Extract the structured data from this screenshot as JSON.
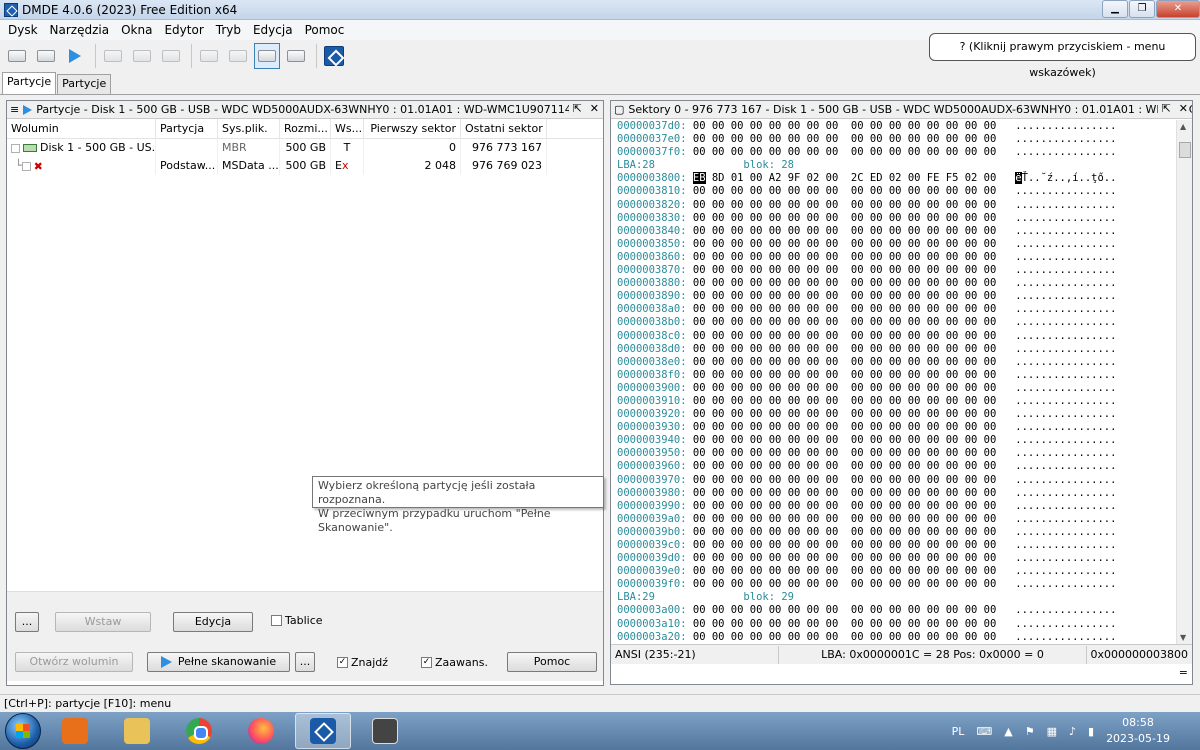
{
  "window": {
    "title": "DMDE 4.0.6 (2023) Free Edition x64"
  },
  "menu": [
    "Dysk",
    "Narzędzia",
    "Okna",
    "Edytor",
    "Tryb",
    "Edycja",
    "Pomoc"
  ],
  "hint": "? (Kliknij prawym przyciskiem - menu wskazówek)",
  "tabs": [
    "Partycje",
    "Partycje"
  ],
  "left_panel": {
    "title": "Partycje - Disk 1 - 500 GB - USB - WDC WD5000AUDX-63WNHY0 : 01.01A01 : WD-WMC1U9071143",
    "columns": [
      "Wolumin",
      "Partycja",
      "Sys.plik.",
      "Rozmi...",
      "Ws...",
      "Pierwszy sektor",
      "Ostatni sektor"
    ],
    "rows": [
      {
        "name": "Disk 1 - 500 GB - US...",
        "partition": "",
        "fs": "MBR",
        "size": "500 GB",
        "flag": "T",
        "first": "0",
        "last": "976 773 167"
      },
      {
        "name": "",
        "partition": "Podstaw...",
        "fs": "MSData ...",
        "size": "500 GB",
        "flag": "E",
        "flag2": "x",
        "first": "2 048",
        "last": "976 769 023"
      }
    ],
    "buttons": {
      "dots1": "...",
      "insert": "Wstaw",
      "edit": "Edycja",
      "tables": "Tablice",
      "open_volume": "Otwórz wolumin",
      "full_scan": "Pełne skanowanie",
      "dots2": "...",
      "find": "Znajdź",
      "advanced": "Zaawans.",
      "help": "Pomoc"
    }
  },
  "tooltip": {
    "line1": "Wybierz określoną partycję jeśli została rozpoznana.",
    "line2": "W przeciwnym przypadku uruchom \"Pełne Skanowanie\"."
  },
  "right_panel": {
    "title": "Sektory 0 - 976 773 167 - Disk 1 - 500 GB - USB - WDC WD5000AUDX-63WNHY0 : 01.01A01 : WD-WMC1U9...",
    "hex_rows": [
      {
        "addr": "00000037d0:",
        "bytes": "00 00 00 00 00 00 00 00  00 00 00 00 00 00 00 00",
        "ascii": "................"
      },
      {
        "addr": "00000037e0:",
        "bytes": "00 00 00 00 00 00 00 00  00 00 00 00 00 00 00 00",
        "ascii": "................"
      },
      {
        "addr": "00000037f0:",
        "bytes": "00 00 00 00 00 00 00 00  00 00 00 00 00 00 00 00",
        "ascii": "................"
      },
      {
        "lba": "LBA:28              blok: 28"
      },
      {
        "addr": "0000003800:",
        "first": "EB",
        "bytes": " 8D 01 00 A2 9F 02 00  2C ED 02 00 FE F5 02 00",
        "afirst": "ë",
        "ascii": "Ť..˘ź..,í..ţő.."
      },
      {
        "addr": "0000003810:",
        "bytes": "00 00 00 00 00 00 00 00  00 00 00 00 00 00 00 00",
        "ascii": "................"
      },
      {
        "addr": "0000003820:",
        "bytes": "00 00 00 00 00 00 00 00  00 00 00 00 00 00 00 00",
        "ascii": "................"
      },
      {
        "addr": "0000003830:",
        "bytes": "00 00 00 00 00 00 00 00  00 00 00 00 00 00 00 00",
        "ascii": "................"
      },
      {
        "addr": "0000003840:",
        "bytes": "00 00 00 00 00 00 00 00  00 00 00 00 00 00 00 00",
        "ascii": "................"
      },
      {
        "addr": "0000003850:",
        "bytes": "00 00 00 00 00 00 00 00  00 00 00 00 00 00 00 00",
        "ascii": "................"
      },
      {
        "addr": "0000003860:",
        "bytes": "00 00 00 00 00 00 00 00  00 00 00 00 00 00 00 00",
        "ascii": "................"
      },
      {
        "addr": "0000003870:",
        "bytes": "00 00 00 00 00 00 00 00  00 00 00 00 00 00 00 00",
        "ascii": "................"
      },
      {
        "addr": "0000003880:",
        "bytes": "00 00 00 00 00 00 00 00  00 00 00 00 00 00 00 00",
        "ascii": "................"
      },
      {
        "addr": "0000003890:",
        "bytes": "00 00 00 00 00 00 00 00  00 00 00 00 00 00 00 00",
        "ascii": "................"
      },
      {
        "addr": "00000038a0:",
        "bytes": "00 00 00 00 00 00 00 00  00 00 00 00 00 00 00 00",
        "ascii": "................"
      },
      {
        "addr": "00000038b0:",
        "bytes": "00 00 00 00 00 00 00 00  00 00 00 00 00 00 00 00",
        "ascii": "................"
      },
      {
        "addr": "00000038c0:",
        "bytes": "00 00 00 00 00 00 00 00  00 00 00 00 00 00 00 00",
        "ascii": "................"
      },
      {
        "addr": "00000038d0:",
        "bytes": "00 00 00 00 00 00 00 00  00 00 00 00 00 00 00 00",
        "ascii": "................"
      },
      {
        "addr": "00000038e0:",
        "bytes": "00 00 00 00 00 00 00 00  00 00 00 00 00 00 00 00",
        "ascii": "................"
      },
      {
        "addr": "00000038f0:",
        "bytes": "00 00 00 00 00 00 00 00  00 00 00 00 00 00 00 00",
        "ascii": "................"
      },
      {
        "addr": "0000003900:",
        "bytes": "00 00 00 00 00 00 00 00  00 00 00 00 00 00 00 00",
        "ascii": "................"
      },
      {
        "addr": "0000003910:",
        "bytes": "00 00 00 00 00 00 00 00  00 00 00 00 00 00 00 00",
        "ascii": "................"
      },
      {
        "addr": "0000003920:",
        "bytes": "00 00 00 00 00 00 00 00  00 00 00 00 00 00 00 00",
        "ascii": "................"
      },
      {
        "addr": "0000003930:",
        "bytes": "00 00 00 00 00 00 00 00  00 00 00 00 00 00 00 00",
        "ascii": "................"
      },
      {
        "addr": "0000003940:",
        "bytes": "00 00 00 00 00 00 00 00  00 00 00 00 00 00 00 00",
        "ascii": "................"
      },
      {
        "addr": "0000003950:",
        "bytes": "00 00 00 00 00 00 00 00  00 00 00 00 00 00 00 00",
        "ascii": "................"
      },
      {
        "addr": "0000003960:",
        "bytes": "00 00 00 00 00 00 00 00  00 00 00 00 00 00 00 00",
        "ascii": "................"
      },
      {
        "addr": "0000003970:",
        "bytes": "00 00 00 00 00 00 00 00  00 00 00 00 00 00 00 00",
        "ascii": "................"
      },
      {
        "addr": "0000003980:",
        "bytes": "00 00 00 00 00 00 00 00  00 00 00 00 00 00 00 00",
        "ascii": "................"
      },
      {
        "addr": "0000003990:",
        "bytes": "00 00 00 00 00 00 00 00  00 00 00 00 00 00 00 00",
        "ascii": "................"
      },
      {
        "addr": "00000039a0:",
        "bytes": "00 00 00 00 00 00 00 00  00 00 00 00 00 00 00 00",
        "ascii": "................"
      },
      {
        "addr": "00000039b0:",
        "bytes": "00 00 00 00 00 00 00 00  00 00 00 00 00 00 00 00",
        "ascii": "................"
      },
      {
        "addr": "00000039c0:",
        "bytes": "00 00 00 00 00 00 00 00  00 00 00 00 00 00 00 00",
        "ascii": "................"
      },
      {
        "addr": "00000039d0:",
        "bytes": "00 00 00 00 00 00 00 00  00 00 00 00 00 00 00 00",
        "ascii": "................"
      },
      {
        "addr": "00000039e0:",
        "bytes": "00 00 00 00 00 00 00 00  00 00 00 00 00 00 00 00",
        "ascii": "................"
      },
      {
        "addr": "00000039f0:",
        "bytes": "00 00 00 00 00 00 00 00  00 00 00 00 00 00 00 00",
        "ascii": "................"
      },
      {
        "lba": "LBA:29              blok: 29"
      },
      {
        "addr": "0000003a00:",
        "bytes": "00 00 00 00 00 00 00 00  00 00 00 00 00 00 00 00",
        "ascii": "................"
      },
      {
        "addr": "0000003a10:",
        "bytes": "00 00 00 00 00 00 00 00  00 00 00 00 00 00 00 00",
        "ascii": "................"
      },
      {
        "addr": "0000003a20:",
        "bytes": "00 00 00 00 00 00 00 00  00 00 00 00 00 00 00 00",
        "ascii": "................"
      },
      {
        "addr": "0000003a30:",
        "bytes": "00 00 00 00 00 00 00 00  00 00 00 00 00 00 00 00",
        "ascii": "................"
      }
    ],
    "status": {
      "encoding": "ANSI (235:-21)",
      "lba": "LBA: 0x0000001C = 28  Pos: 0x0000 = 0",
      "offset": "0x000000003800 ="
    }
  },
  "statusbar": "[Ctrl+P]: partycje  [F10]: menu",
  "taskbar": {
    "lang": "PL",
    "time": "08:58",
    "date": "2023-05-19"
  }
}
